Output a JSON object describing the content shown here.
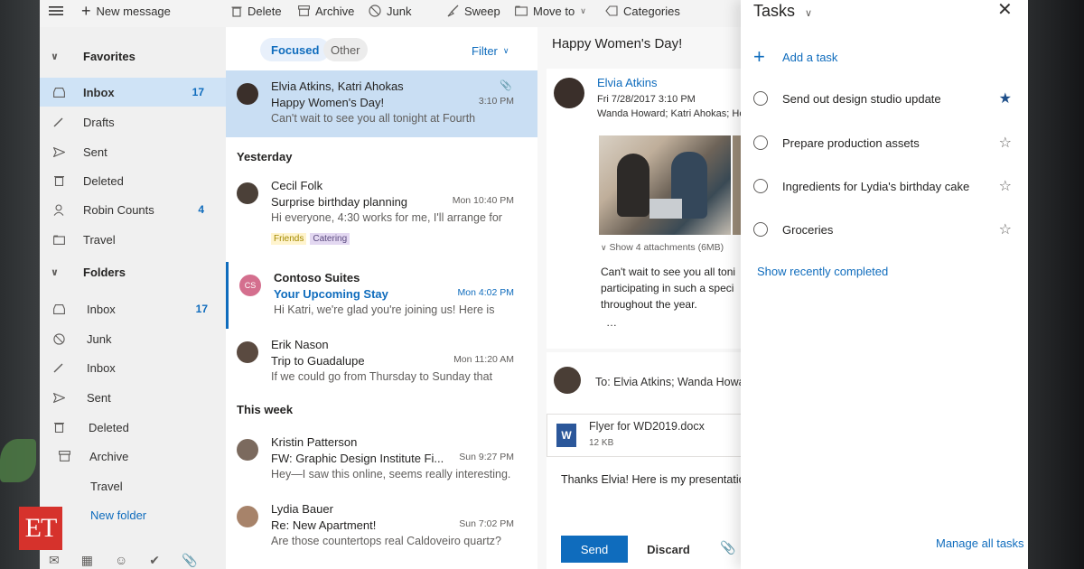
{
  "toolbar": {
    "new_message": "New message",
    "delete": "Delete",
    "archive": "Archive",
    "junk": "Junk",
    "sweep": "Sweep",
    "move_to": "Move to",
    "categories": "Categories"
  },
  "nav": {
    "favorites_header": "Favorites",
    "favorites": [
      {
        "label": "Inbox",
        "count": "17",
        "icon": "inbox-icon"
      },
      {
        "label": "Drafts",
        "count": "",
        "icon": "pencil-icon"
      },
      {
        "label": "Sent",
        "count": "",
        "icon": "send-icon"
      },
      {
        "label": "Deleted",
        "count": "",
        "icon": "trash-icon"
      },
      {
        "label": "Robin Counts",
        "count": "4",
        "icon": "person-icon"
      },
      {
        "label": "Travel",
        "count": "",
        "icon": "folder-icon"
      }
    ],
    "folders_header": "Folders",
    "folders": [
      {
        "label": "Inbox",
        "count": "17",
        "icon": "inbox-icon"
      },
      {
        "label": "Junk",
        "count": "",
        "icon": "block-icon"
      },
      {
        "label": "Inbox",
        "count": "",
        "icon": "pencil-icon"
      },
      {
        "label": "Sent",
        "count": "",
        "icon": "send-icon"
      },
      {
        "label": "Deleted",
        "count": "",
        "icon": "trash-icon"
      },
      {
        "label": "Archive",
        "count": "",
        "icon": "archive-icon"
      },
      {
        "label": "Travel",
        "count": "",
        "icon": ""
      }
    ],
    "new_folder": "New folder"
  },
  "list": {
    "tab_focused": "Focused",
    "tab_other": "Other",
    "filter": "Filter",
    "group_yesterday": "Yesterday",
    "group_this_week": "This week",
    "messages": [
      {
        "from": "Elvia Atkins, Katri Ahokas",
        "subject": "Happy Women's Day!",
        "preview": "Can't wait to see you all tonight at Fourth",
        "time": "3:10 PM"
      },
      {
        "from": "Cecil Folk",
        "subject": "Surprise birthday planning",
        "preview": "Hi everyone, 4:30 works for me, I'll arrange for",
        "time": "Mon 10:40 PM",
        "cat1": "Friends",
        "cat2": "Catering"
      },
      {
        "from": "Contoso Suites",
        "subject": "Your Upcoming Stay",
        "preview": "Hi Katri, we're glad you're joining us! Here is",
        "time": "Mon 4:02 PM",
        "initials": "CS"
      },
      {
        "from": "Erik Nason",
        "subject": "Trip to Guadalupe",
        "preview": "If we could go from Thursday to Sunday that",
        "time": "Mon 11:20 AM"
      },
      {
        "from": "Kristin Patterson",
        "subject": "FW: Graphic Design Institute Fi...",
        "preview": "Hey—I saw this online, seems really interesting.",
        "time": "Sun 9:27 PM"
      },
      {
        "from": "Lydia Bauer",
        "subject": "Re: New Apartment!",
        "preview": "Are those countertops real Caldoveiro quartz?",
        "time": "Sun 7:02 PM"
      }
    ]
  },
  "reading": {
    "title": "Happy Women's Day!",
    "sender": "Elvia Atkins",
    "date": "Fri 7/28/2017 3:10 PM",
    "recipients": "Wanda Howard; Katri Ahokas; He",
    "show_attachments": "Show 4 attachments (6MB)",
    "body_lines": [
      "Can't wait to see you all toni",
      "participating in such a speci",
      "throughout the year."
    ],
    "more": "…",
    "reply_to": "To: Elvia Atkins; Wanda Howa",
    "attachment_name": "Flyer for WD2019.docx",
    "attachment_size": "12 KB",
    "reply_body": "Thanks Elvia! Here is my presentation",
    "send": "Send",
    "discard": "Discard"
  },
  "tasks": {
    "title": "Tasks",
    "add_task": "Add a task",
    "items": [
      {
        "label": "Send out design studio update",
        "important": true
      },
      {
        "label": "Prepare production assets",
        "important": false
      },
      {
        "label": "Ingredients for Lydia's birthday cake",
        "important": false
      },
      {
        "label": "Groceries",
        "important": false
      }
    ],
    "show_completed": "Show recently completed",
    "manage_all": "Manage all tasks"
  },
  "watermark": {
    "text": "ET"
  },
  "colors": {
    "accent": "#0f6cbd",
    "selected_row": "#c9def3",
    "nav_selected": "#cfe3f6",
    "brand_red": "#d6322c"
  }
}
